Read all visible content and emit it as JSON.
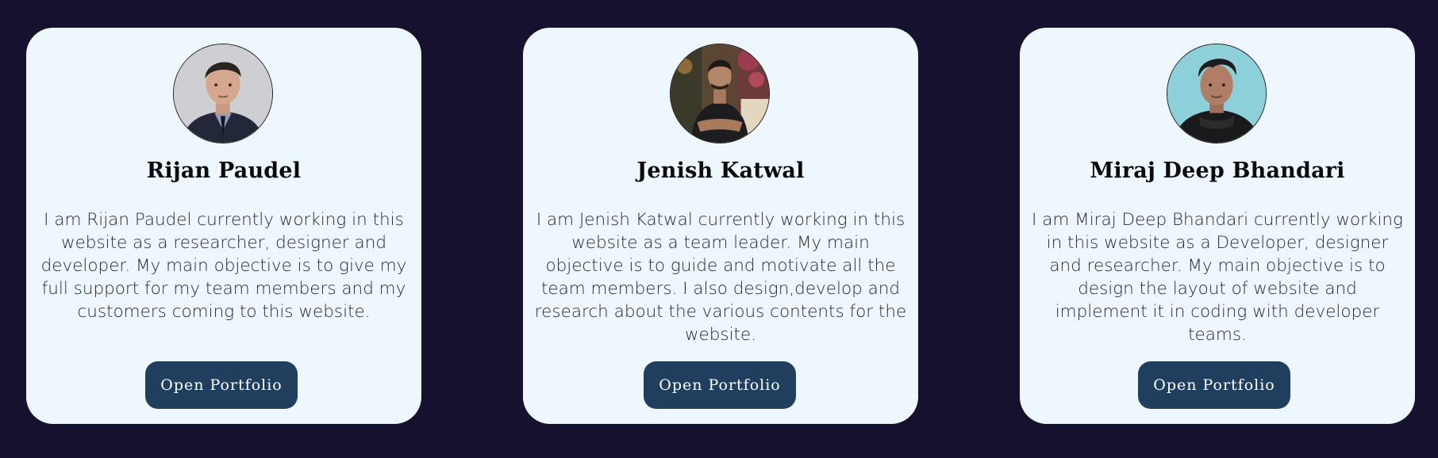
{
  "members": [
    {
      "name": "Rijan Paudel",
      "bio": "I am Rijan Paudel currently working in this website as a researcher, designer and developer. My main objective is to give my full support for my team members and my customers coming to this website.",
      "button_label": "Open Portfolio",
      "avatar_icon": "profile-photo-icon"
    },
    {
      "name": "Jenish Katwal",
      "bio": "I am Jenish Katwal currently working in this website as a team leader. My main objective is to guide and motivate all the team members. I also design,develop and research about the various contents for the website.",
      "button_label": "Open Portfolio",
      "avatar_icon": "profile-photo-icon"
    },
    {
      "name": "Miraj Deep Bhandari",
      "bio": "I am Miraj Deep Bhandari currently working in this website as a Developer, designer and researcher. My main objective is to design the layout of website and implement it in coding with developer teams.",
      "button_label": "Open Portfolio",
      "avatar_icon": "profile-photo-icon"
    }
  ],
  "colors": {
    "page_background": "#16112e",
    "card_background": "#eef7fe",
    "button_background": "#203f5f",
    "button_text": "#ffffff"
  }
}
